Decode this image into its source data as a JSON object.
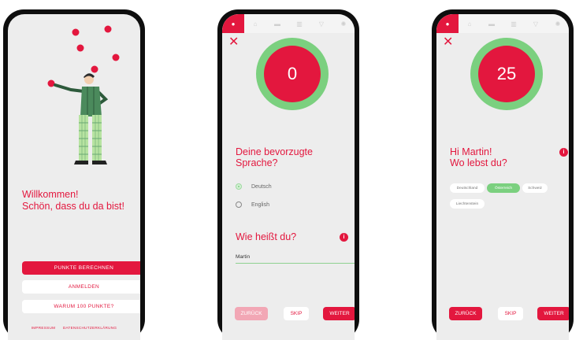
{
  "colors": {
    "accent": "#e3173e",
    "green": "#7bd07f",
    "background": "#ededed"
  },
  "screen_welcome": {
    "heading_line1": "Willkommen!",
    "heading_line2": "Schön, dass du da bist!",
    "btn_calc": "PUNKTE BERECHNEN",
    "btn_login": "ANMELDEN",
    "btn_why": "WARUM 100 PUNKTE?",
    "link_imprint": "IMPRESSUM",
    "link_privacy": "DATENSCHUTZERKLÄRUNG"
  },
  "nav_icons": [
    "location-pin-icon",
    "home-icon",
    "car-icon",
    "building-icon",
    "cart-icon",
    "sun-icon"
  ],
  "screen_language": {
    "score": "0",
    "question_line1": "Deine bevorzugte",
    "question_line2": "Sprache?",
    "options": [
      "Deutsch",
      "English"
    ],
    "selected": "Deutsch",
    "name_question": "Wie heißt du?",
    "name_value": "Martin",
    "back": "ZURÜCK",
    "skip": "SKIP",
    "next": "WEITER"
  },
  "screen_location": {
    "score": "25",
    "question_line1": "Hi Martin!",
    "question_line2": "Wo lebst du?",
    "countries": [
      "Deutschland",
      "Österreich",
      "Schweiz",
      "Liechtenstein"
    ],
    "selected": "Österreich",
    "back": "ZURÜCK",
    "skip": "SKIP",
    "next": "WEITER"
  }
}
